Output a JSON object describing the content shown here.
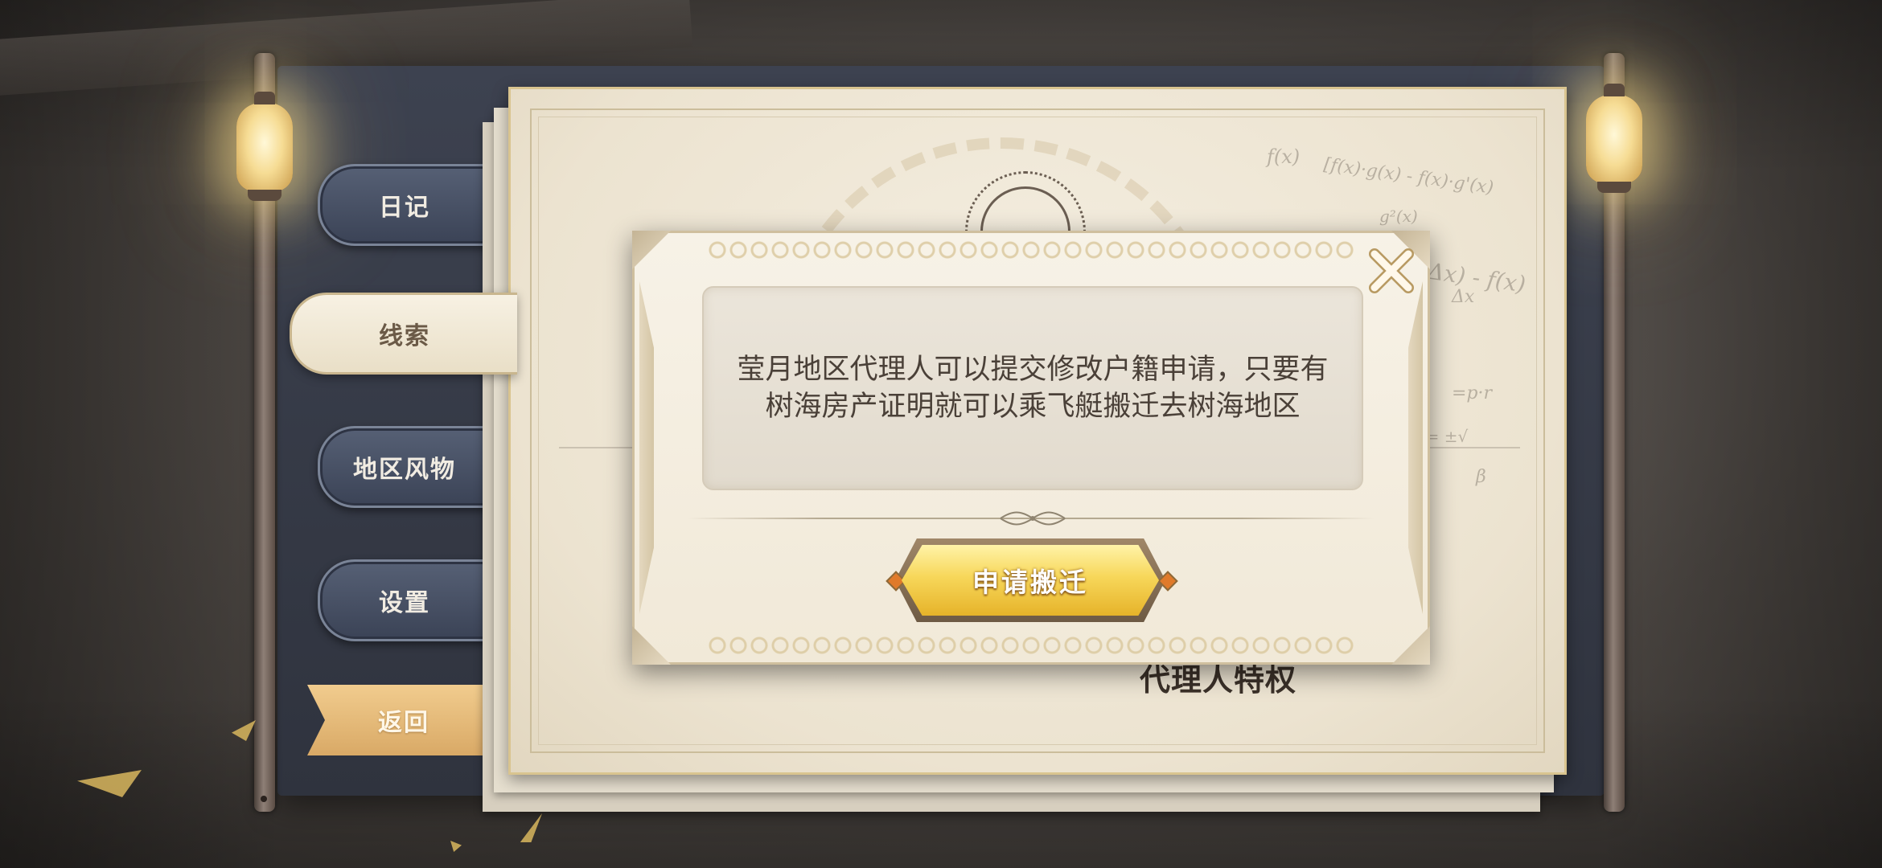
{
  "menu": {
    "diary": "日记",
    "clues": "线索",
    "region": "地区风物",
    "settings": "设置",
    "back": "返回",
    "selected": "线索"
  },
  "page": {
    "caption": "代理人特权",
    "scribbles": [
      "f(x)",
      "[f(x)·g(x) - f(x)·g'(x)",
      "g²(x)",
      "Δx) - f(x)",
      "Δx",
      "=p·r",
      "x = ±√",
      "β"
    ]
  },
  "dialog": {
    "message": "莹月地区代理人可以提交修改户籍申请，只要有树海房产证明就可以乘飞艇搬迁去树海地区",
    "apply_button": "申请搬迁",
    "close_icon": "close-icon"
  },
  "colors": {
    "accent_gold": "#f7d75a",
    "tab_dark": "#3b4356",
    "tab_selected": "#f7f1e3",
    "back_tab": "#d9a966",
    "paper": "#f5efe2"
  }
}
